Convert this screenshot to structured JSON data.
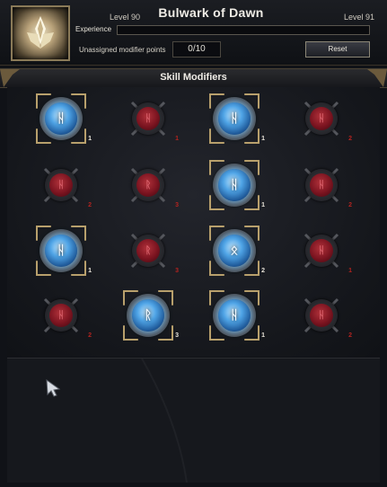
{
  "header": {
    "title": "Bulwark of Dawn",
    "level_current": "Level 90",
    "level_next": "Level 91",
    "experience_label": "Experience",
    "experience_fraction": 0.0,
    "unassigned_label": "Unassigned modifier points",
    "points_value": "0/10",
    "reset_label": "Reset",
    "class_icon": "holy-shield-emblem-icon"
  },
  "section": {
    "title": "Skill Modifiers"
  },
  "modifiers": [
    {
      "state": "active",
      "frame": true,
      "glyph": "ᚺ",
      "rank": "1"
    },
    {
      "state": "inactive",
      "frame": false,
      "glyph": "ᚺ",
      "rank": "1"
    },
    {
      "state": "active",
      "frame": true,
      "glyph": "ᚺ",
      "rank": "1"
    },
    {
      "state": "inactive",
      "frame": false,
      "glyph": "ᚺ",
      "rank": "2"
    },
    {
      "state": "inactive",
      "frame": false,
      "glyph": "ᚺ",
      "rank": "2"
    },
    {
      "state": "inactive",
      "frame": false,
      "glyph": "ᚱ",
      "rank": "3"
    },
    {
      "state": "active",
      "frame": true,
      "glyph": "ᚺ",
      "rank": "1"
    },
    {
      "state": "inactive",
      "frame": false,
      "glyph": "ᚺ",
      "rank": "2"
    },
    {
      "state": "active",
      "frame": true,
      "glyph": "ᚺ",
      "rank": "1"
    },
    {
      "state": "inactive",
      "frame": false,
      "glyph": "ᚱ",
      "rank": "3"
    },
    {
      "state": "active",
      "frame": true,
      "glyph": "ᛟ",
      "rank": "2"
    },
    {
      "state": "inactive",
      "frame": false,
      "glyph": "ᚺ",
      "rank": "1"
    },
    {
      "state": "inactive",
      "frame": false,
      "glyph": "ᚺ",
      "rank": "2"
    },
    {
      "state": "active",
      "frame": true,
      "glyph": "ᚱ",
      "rank": "3"
    },
    {
      "state": "active",
      "frame": true,
      "glyph": "ᚺ",
      "rank": "1"
    },
    {
      "state": "inactive",
      "frame": false,
      "glyph": "ᚺ",
      "rank": "2"
    }
  ],
  "colors": {
    "active_gem": "#4fa4e6",
    "inactive_gem": "#7b1420",
    "frame_gold": "#b8a06c",
    "inactive_rank": "#b3231f"
  },
  "cursor_icon": "arrow-cursor-icon"
}
